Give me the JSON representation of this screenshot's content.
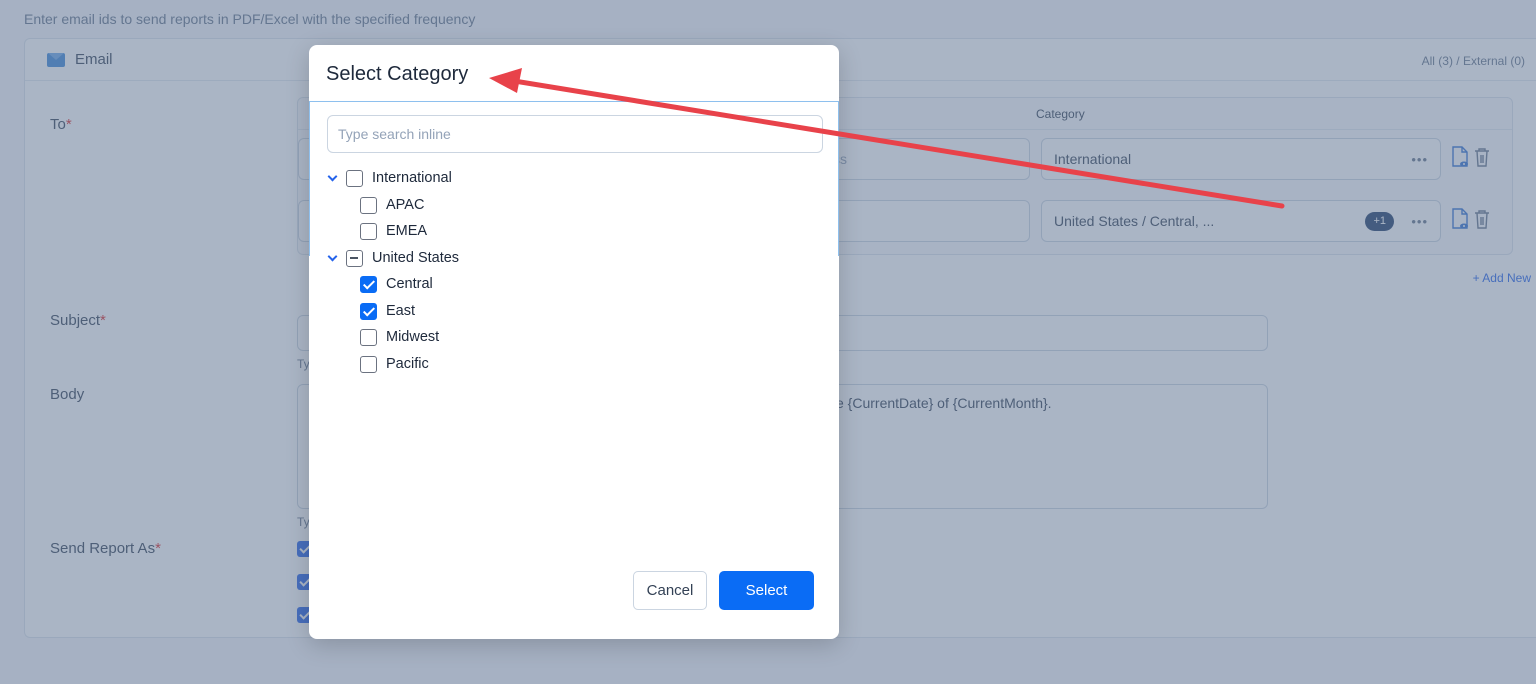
{
  "page": {
    "intro": "Enter email ids to send reports in PDF/Excel with the specified frequency"
  },
  "email_card": {
    "title": "Email",
    "counts": "All (3) / External (0)",
    "to_label": "To",
    "required_mark": "*",
    "recipients": {
      "category_header": "Category",
      "rows": [
        {
          "email_placeholder_fragment": "ss",
          "category": "International",
          "extra_badge": ""
        },
        {
          "email_placeholder_fragment": "",
          "category": "United States / Central, ...",
          "extra_badge": "+1"
        }
      ],
      "more_label": "•••",
      "add_new": "+ Add New"
    },
    "subject_label": "Subject",
    "subject_hint": "Ty",
    "body_label": "Body",
    "body_text_fragment": "e {CurrentDate} of {CurrentMonth}.",
    "body_hint": "Ty",
    "send_as_label": "Send Report As",
    "send_as_options": [
      {
        "checked": true
      },
      {
        "checked": true
      },
      {
        "checked": true
      }
    ]
  },
  "modal": {
    "title": "Select Category",
    "search_placeholder": "Type search inline",
    "search_value": "",
    "tree": [
      {
        "label": "International",
        "level": 0,
        "expanded": true,
        "state": "unchecked"
      },
      {
        "label": "APAC",
        "level": 1,
        "state": "unchecked"
      },
      {
        "label": "EMEA",
        "level": 1,
        "state": "unchecked"
      },
      {
        "label": "United States",
        "level": 0,
        "expanded": true,
        "state": "partial"
      },
      {
        "label": "Central",
        "level": 1,
        "state": "checked"
      },
      {
        "label": "East",
        "level": 1,
        "state": "checked"
      },
      {
        "label": "Midwest",
        "level": 1,
        "state": "unchecked"
      },
      {
        "label": "Pacific",
        "level": 1,
        "state": "unchecked"
      }
    ],
    "cancel_label": "Cancel",
    "select_label": "Select"
  },
  "colors": {
    "primary": "#0a6cf5",
    "badge": "#1e3a66",
    "required": "#dc2626",
    "annotation_arrow": "#e8424a"
  }
}
